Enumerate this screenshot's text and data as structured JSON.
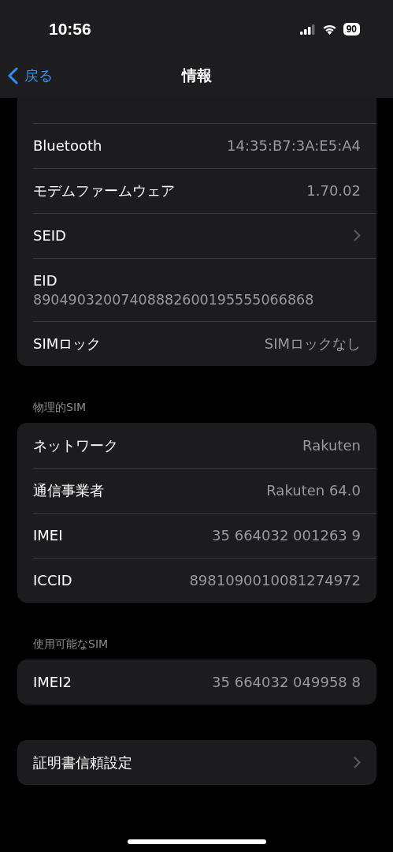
{
  "status_bar": {
    "time": "10:56",
    "battery": "90"
  },
  "nav": {
    "back": "戻る",
    "title": "情報"
  },
  "sections": [
    {
      "rows": [
        {
          "kind": "value",
          "label": "Bluetooth",
          "value": "14:35:B7:3A:E5:A4"
        },
        {
          "kind": "value",
          "label": "モデムファームウェア",
          "value": "1.70.02"
        },
        {
          "kind": "chevron",
          "label": "SEID"
        },
        {
          "kind": "stacked",
          "label": "EID",
          "value": "89049032007408882600195555066868"
        },
        {
          "kind": "value",
          "label": "SIMロック",
          "value": "SIMロックなし"
        }
      ]
    },
    {
      "header": "物理的SIM",
      "rows": [
        {
          "kind": "value",
          "label": "ネットワーク",
          "value": "Rakuten"
        },
        {
          "kind": "value",
          "label": "通信事業者",
          "value": "Rakuten 64.0"
        },
        {
          "kind": "value",
          "label": "IMEI",
          "value": "35 664032 001263 9"
        },
        {
          "kind": "value",
          "label": "ICCID",
          "value": "8981090010081274972"
        }
      ]
    },
    {
      "header": "使用可能なSIM",
      "rows": [
        {
          "kind": "value",
          "label": "IMEI2",
          "value": "35 664032 049958 8"
        }
      ]
    },
    {
      "rows": [
        {
          "kind": "chevron",
          "label": "証明書信頼設定"
        }
      ]
    }
  ]
}
